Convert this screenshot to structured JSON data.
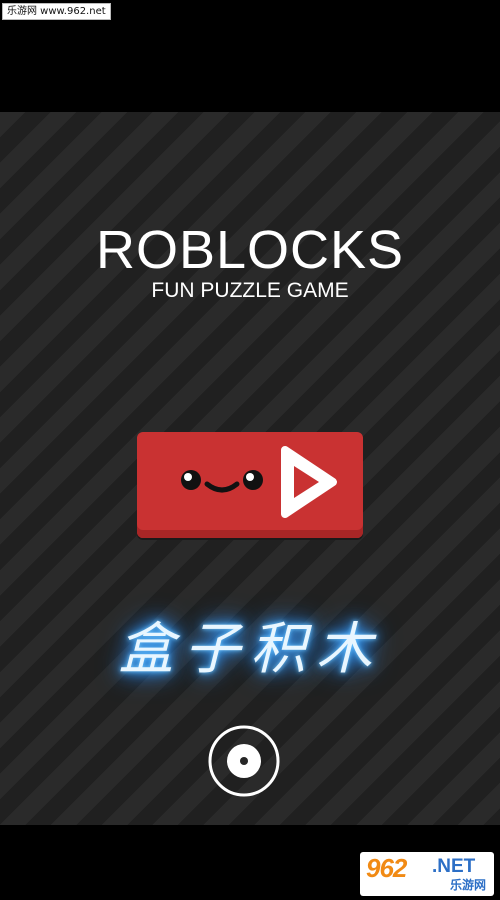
{
  "watermark_top": {
    "text": "乐游网 www.962.net"
  },
  "game": {
    "title": "ROBLOCKS",
    "subtitle": "FUN PUZZLE GAME",
    "chinese_title": "盒子积木",
    "play_button": {
      "icon": "play-icon",
      "face_icon": "smiley-face-icon",
      "color": "#c93232"
    },
    "sound_button": {
      "icon": "sound-toggle-icon"
    }
  },
  "watermark_bottom": {
    "brand": "962",
    "net": ".NET",
    "cn": "乐游网"
  },
  "colors": {
    "background_stripe_light": "#2a2a2a",
    "background_stripe_dark": "#202020",
    "glow": "#3ea8ff"
  }
}
